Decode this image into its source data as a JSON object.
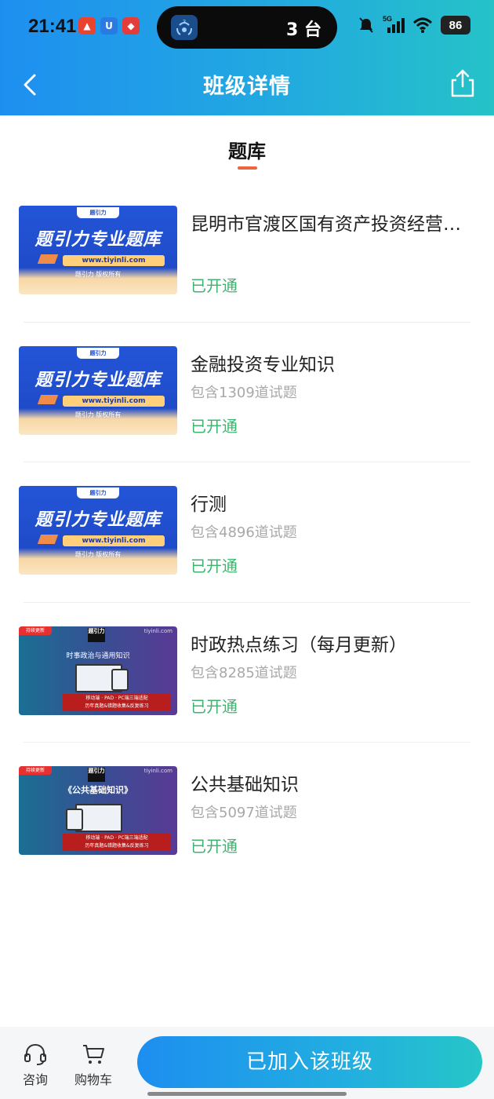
{
  "status_bar": {
    "time": "21:41",
    "island_badge": "3",
    "island_text": "3 台",
    "network": "5G",
    "battery": "86"
  },
  "nav": {
    "title": "班级详情",
    "back_icon": "chevron-left-icon",
    "share_icon": "share-icon"
  },
  "tab": {
    "label": "题库",
    "indicator_color": "#f0643c"
  },
  "thumb_text": {
    "blue_main": "题引力专业题库",
    "blue_url": "www.tiyinli.com",
    "blue_copyright": "题引力 版权所有",
    "blue_logo": "题引力",
    "grad_badge": "持续更新",
    "grad_url": "tiyinli.com",
    "grad_logo": "题引力",
    "grad_band_1": "移动端 · PAD · PC端三端适配",
    "grad_band_2": "历年真题&错题收集&反复练习"
  },
  "items": [
    {
      "title": "昆明市官渡区国有资产投资经营有限公司",
      "subtitle": "",
      "status": "已开通",
      "thumb_style": "blue"
    },
    {
      "title": "金融投资专业知识",
      "subtitle": "包含1309道试题",
      "status": "已开通",
      "thumb_style": "blue"
    },
    {
      "title": "行测",
      "subtitle": "包含4896道试题",
      "status": "已开通",
      "thumb_style": "blue"
    },
    {
      "title": "时政热点练习（每月更新）",
      "subtitle": "包含8285道试题",
      "status": "已开通",
      "thumb_style": "gradient",
      "thumb_title": "时事政治与通用知识"
    },
    {
      "title": "公共基础知识",
      "subtitle": "包含5097道试题",
      "status": "已开通",
      "thumb_style": "gradient",
      "thumb_title": "《公共基础知识》"
    }
  ],
  "bottom_bar": {
    "consult_label": "咨询",
    "cart_label": "购物车",
    "join_label": "已加入该班级"
  },
  "colors": {
    "accent_start": "#1d8ef0",
    "accent_end": "#26c6c8",
    "status_green": "#3cb46e"
  }
}
